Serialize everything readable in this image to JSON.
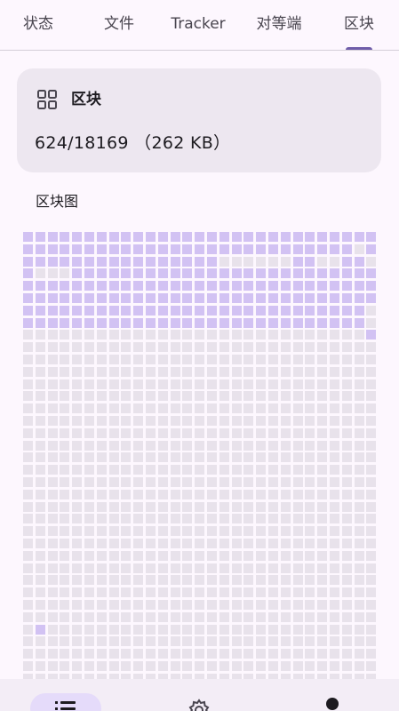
{
  "tabs": [
    "状态",
    "文件",
    "Tracker",
    "对等端",
    "区块"
  ],
  "active_tab": 4,
  "pieces_card": {
    "icon": "grid-icon",
    "title": "区块",
    "value": "624/18169 （262 KB）"
  },
  "piece_map": {
    "title": "区块图",
    "columns": 29,
    "rows": 37,
    "rows_state": [
      "11111111111111111111111111111",
      "11111111111111111111111111101",
      "11111111111111110000001100110",
      "10001111111111111111111111111",
      "11111111111111111111111111111",
      "11111111111111111111111111111",
      "11111111111111111111111111110",
      "11111111111111111111111111110",
      "00000000000000000000000000001",
      "00000000000000000000000000000",
      "00000000000000000000000000000",
      "00000000000000000000000000000",
      "00000000000000000000000000000",
      "00000000000000000000000000000",
      "00000000000000000000000000000",
      "00000000000000000000000000000",
      "00000000000000000000000000000",
      "00000000000000000000000000000",
      "00000000000000000000000000000",
      "00000000000000000000000000000",
      "00000000000000000000000000000",
      "00000000000000000000000000000",
      "00000000000000000000000000000",
      "00000000000000000000000000000",
      "00000000000000000000000000000",
      "00000000000000000000000000000",
      "00000000000000000000000000000",
      "00000000000000000000000000000",
      "00000000000000000000000000000",
      "00000000000000000000000000000",
      "00000000000000000000000000000",
      "00000000000000000000000000000",
      "01000000000000000000000000000",
      "00000000000000000000000000000",
      "00000000000000000000000000000",
      "00000000000000000000000000000",
      "00000000000000000000000000000"
    ],
    "colors": {
      "downloaded": "#d2c2f3",
      "missing": "#e8e2eb"
    }
  },
  "bottom_nav": {
    "items": [
      {
        "icon": "list-icon",
        "selected": true
      },
      {
        "icon": "settings-icon",
        "selected": false
      },
      {
        "icon": "profile-icon",
        "selected": false
      }
    ]
  }
}
